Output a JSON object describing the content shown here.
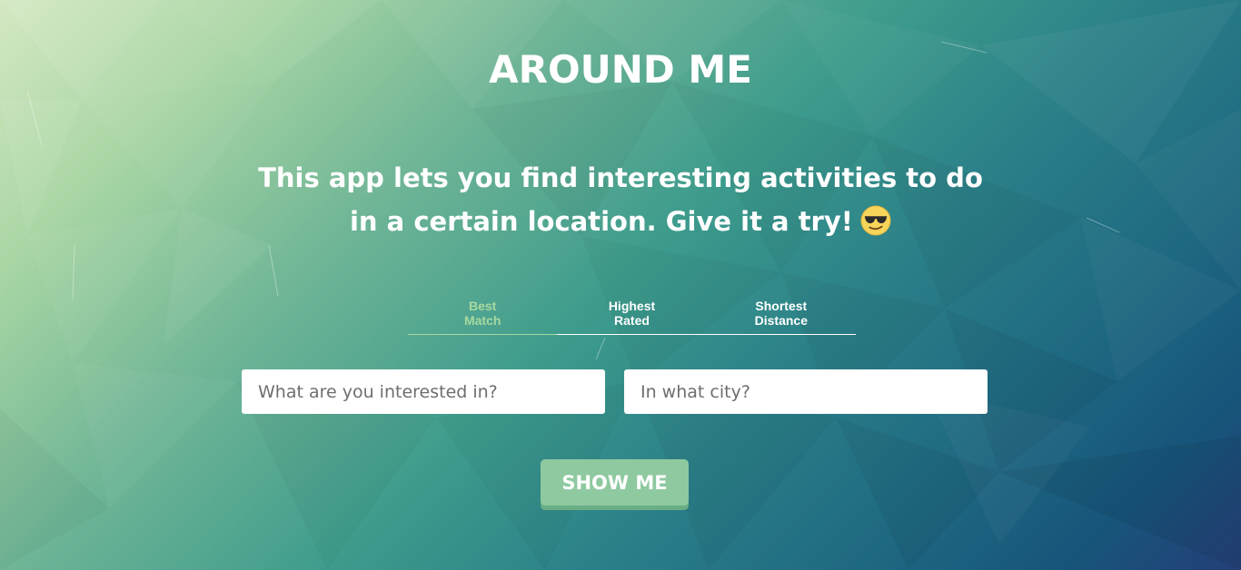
{
  "app": {
    "title": "AROUND ME",
    "tagline": "This app lets you find interesting activities to do in a certain location. Give it a try!",
    "tagline_emoji_icon": "sunglasses-face-icon"
  },
  "sort": {
    "options": [
      {
        "line1": "Best",
        "line2": "Match",
        "active": true
      },
      {
        "line1": "Highest",
        "line2": "Rated",
        "active": false
      },
      {
        "line1": "Shortest",
        "line2": "Distance",
        "active": false
      }
    ],
    "active_color": "#a8d8a0"
  },
  "search": {
    "term_placeholder": "What are you interested in?",
    "location_placeholder": "In what city?",
    "submit_label": "SHOW ME"
  },
  "colors": {
    "button": "#8fc9a0",
    "text": "#ffffff"
  }
}
